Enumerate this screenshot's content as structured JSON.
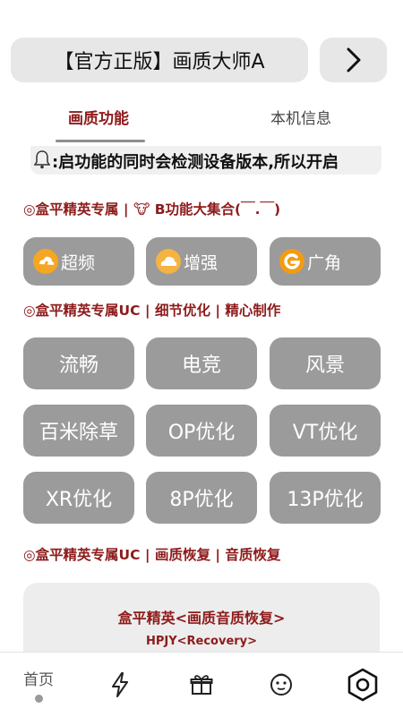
{
  "header": {
    "title": "【官方正版】画质大师A",
    "next_icon": "chevron-right-icon"
  },
  "tabs": {
    "active": "画质功能",
    "inactive": "本机信息"
  },
  "notice": {
    "icon": "bell-icon",
    "text": ":启功能的同时会检测设备版本,所以开启"
  },
  "sections": {
    "s1_title": "◎盒平精英专属 | 🐮 B功能大集合(￣.￣)",
    "s2_title": "◎盒平精英专属UC | 细节优化 | 精心制作",
    "s3_title": "◎盒平精英专属UC | 画质恢复 | 音质恢复"
  },
  "feature_buttons": [
    {
      "label": "超频",
      "icon": "lightning-cloud-icon"
    },
    {
      "label": "增强",
      "icon": "cloud-icon"
    },
    {
      "label": "广角",
      "icon": "g-logo-icon"
    }
  ],
  "opt_buttons": [
    {
      "label": "流畅"
    },
    {
      "label": "电竞"
    },
    {
      "label": "风景"
    },
    {
      "label": "百米除草"
    },
    {
      "label": "OP优化"
    },
    {
      "label": "VT优化"
    },
    {
      "label": "XR优化"
    },
    {
      "label": "8P优化"
    },
    {
      "label": "13P优化"
    }
  ],
  "card": {
    "title": "盒平精英<画质音质恢复>",
    "subtitle": "HPJY<Recovery>"
  },
  "bottom_nav": {
    "home_label": "首页",
    "items": [
      "lightning-icon",
      "gift-icon",
      "face-icon",
      "hexagon-settings-icon"
    ]
  },
  "colors": {
    "accent": "#8e1b1b",
    "button_gray": "#9b9b9b",
    "pill_gray": "#e7e7e7"
  }
}
